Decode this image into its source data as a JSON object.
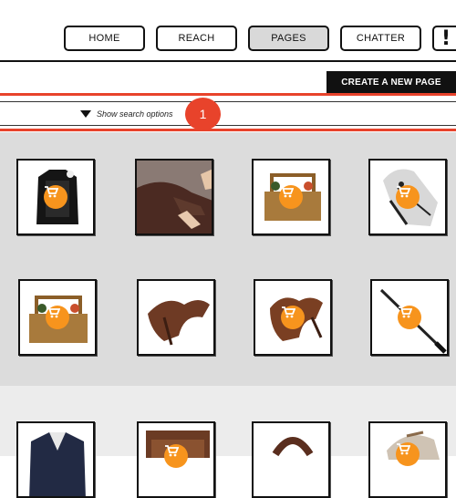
{
  "nav": {
    "items": [
      {
        "label": "HOME",
        "active": false
      },
      {
        "label": "REACH",
        "active": false
      },
      {
        "label": "PAGES",
        "active": true
      },
      {
        "label": "CHATTER",
        "active": false
      }
    ],
    "alert_label": "!"
  },
  "toolbar": {
    "create_label": "CREATE A NEW PAGE"
  },
  "search": {
    "toggle_label": "Show search options"
  },
  "annotation": {
    "step_number": "1"
  },
  "colors": {
    "accent": "#e8432b",
    "cart_badge": "#f7941d",
    "grid_bg": "#dcdcdc"
  },
  "products": [
    {
      "icon": "body-protector-vest-image"
    },
    {
      "icon": "horse-grooming-photo-image"
    },
    {
      "icon": "grooming-box-image"
    },
    {
      "icon": "horse-bridle-head-image"
    },
    {
      "icon": "grooming-box-image"
    },
    {
      "icon": "english-saddle-image"
    },
    {
      "icon": "english-saddle-image"
    },
    {
      "icon": "riding-crop-image"
    },
    {
      "icon": "riding-jacket-image"
    },
    {
      "icon": "leather-item-image"
    },
    {
      "icon": "girth-strap-image"
    },
    {
      "icon": "horse-head-image"
    }
  ]
}
